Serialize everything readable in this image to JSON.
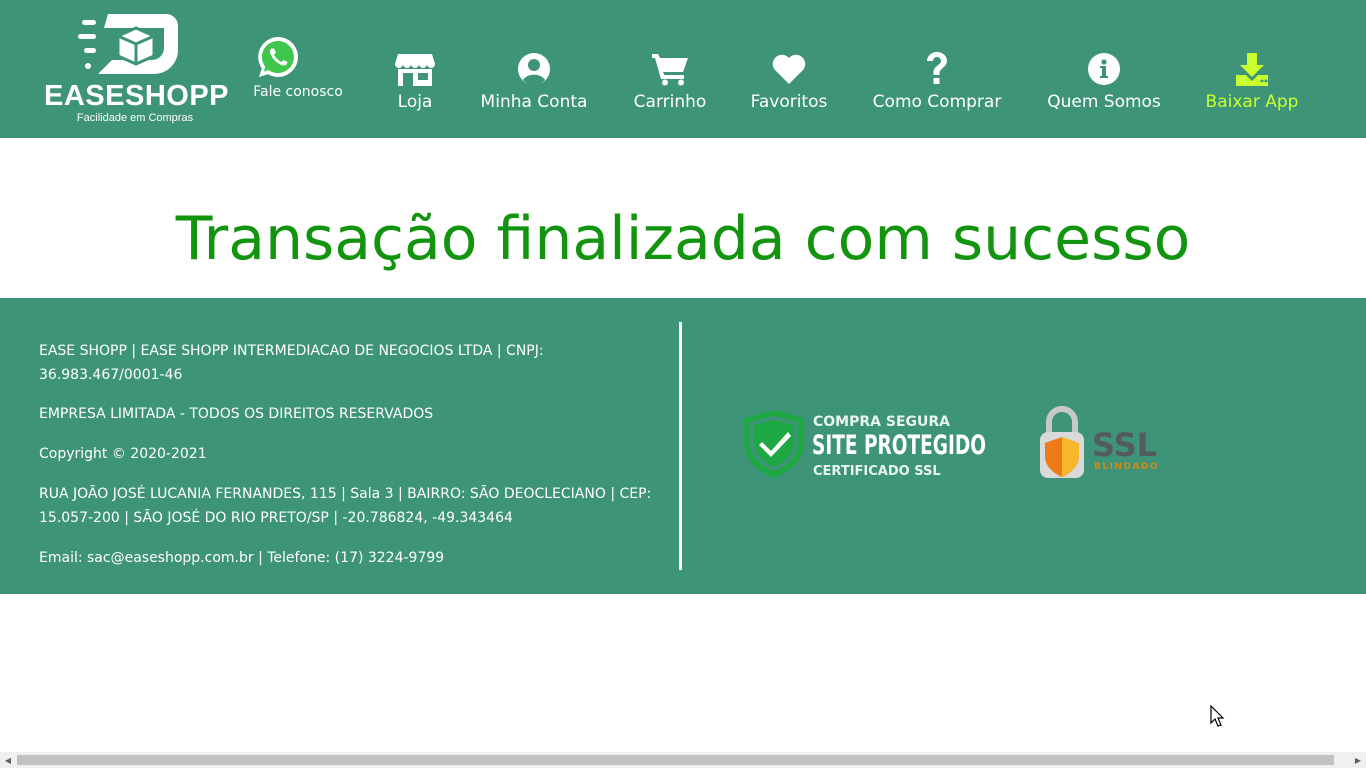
{
  "header": {
    "logo": {
      "title": "EASESHOPP",
      "tagline": "Facilidade em Compras"
    },
    "whatsapp": {
      "label": "Fale conosco",
      "icon": "whatsapp-icon"
    },
    "nav": [
      {
        "label": "Loja",
        "icon": "store-icon"
      },
      {
        "label": "Minha Conta",
        "icon": "user-circle-icon"
      },
      {
        "label": "Carrinho",
        "icon": "cart-icon"
      },
      {
        "label": "Favoritos",
        "icon": "heart-icon"
      },
      {
        "label": "Como Comprar",
        "icon": "question-icon"
      },
      {
        "label": "Quem Somos",
        "icon": "info-icon"
      },
      {
        "label": "Baixar App",
        "icon": "download-icon"
      }
    ]
  },
  "main": {
    "title": "Transação finalizada com sucesso"
  },
  "footer": {
    "company_line1": "EASE SHOPP | EASE SHOPP INTERMEDIACAO DE NEGOCIOS LTDA | CNPJ:",
    "company_line2": "36.983.467/0001-46",
    "rights": "EMPRESA LIMITADA - TODOS OS DIREITOS RESERVADOS",
    "copyright": "Copyright © 2020-2021",
    "address_line1": "RUA JOÃO JOSÉ LUCANIA FERNANDES, 115 | Sala 3 | BAIRRO: SÃO DEOCLECIANO | CEP:",
    "address_line2": "15.057-200 | SÃO JOSÉ DO RIO PRETO/SP | -20.786824, -49.343464",
    "contact": "Email: sac@easeshopp.com.br | Telefone: (17) 3224-9799",
    "badges": {
      "site": {
        "top": "COMPRA SEGURA",
        "main": "SITE PROTEGIDO",
        "bottom": "CERTIFICADO SSL"
      },
      "ssl": {
        "main": "SSL",
        "bottom": "BLINDADO"
      }
    }
  },
  "colors": {
    "brand_green": "#3e9478",
    "title_green": "#12940e",
    "accent_lime": "#c9ff2e",
    "white": "#ffffff"
  }
}
